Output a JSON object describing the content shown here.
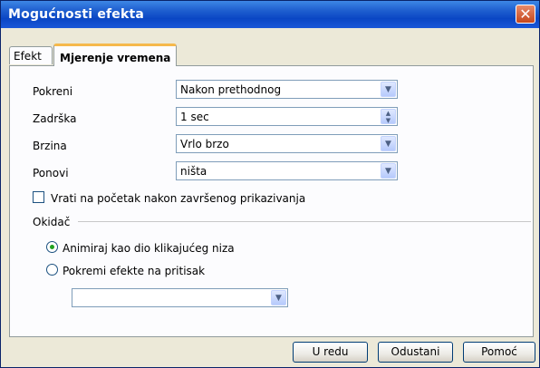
{
  "window": {
    "title": "Mogućnosti efekta",
    "close_glyph": "✕"
  },
  "tabs": [
    {
      "label": "Efekt",
      "active": false
    },
    {
      "label": "Mjerenje vremena",
      "active": true
    }
  ],
  "fields": {
    "pokreni": {
      "label": "Pokreni",
      "value": "Nakon prethodnog"
    },
    "zadrska": {
      "label": "Zadrška",
      "value": "1 sec"
    },
    "brzina": {
      "label": "Brzina",
      "value": "Vrlo brzo"
    },
    "ponovi": {
      "label": "Ponovi",
      "value": "ništa"
    }
  },
  "checkbox": {
    "label": "Vrati na početak nakon završenog prikazivanja",
    "checked": false
  },
  "trigger": {
    "heading": "Okidač",
    "option1": {
      "label": "Animiraj kao dio klikajućeg niza",
      "selected": true
    },
    "option2": {
      "label": "Pokremi efekte na pritisak",
      "selected": false
    },
    "shape_select_value": ""
  },
  "buttons": {
    "ok": "U redu",
    "cancel": "Odustani",
    "help": "Pomoć"
  },
  "colors": {
    "titlebar": "#0a46c4",
    "dialog_bg": "#ece9d8",
    "tab_highlight": "#f5b94c",
    "radio_dot": "#21a121"
  }
}
